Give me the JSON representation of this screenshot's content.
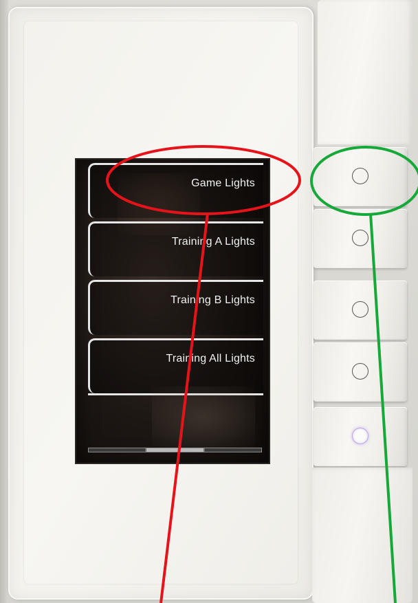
{
  "device": {
    "menu_items": [
      {
        "label": "Game Lights"
      },
      {
        "label": "Training A Lights"
      },
      {
        "label": "Training B Lights"
      },
      {
        "label": "Training All Lights"
      }
    ],
    "scroll_pages": 3,
    "active_scroll_page": 2,
    "keys": [
      {
        "name": "key-1",
        "lit": false
      },
      {
        "name": "key-2",
        "lit": false
      },
      {
        "name": "key-3",
        "lit": false
      },
      {
        "name": "key-4",
        "lit": false
      },
      {
        "name": "key-5",
        "lit": true
      }
    ]
  },
  "annotations": {
    "highlight_color_label": "#e5141b",
    "highlight_color_button": "#17a83a"
  }
}
